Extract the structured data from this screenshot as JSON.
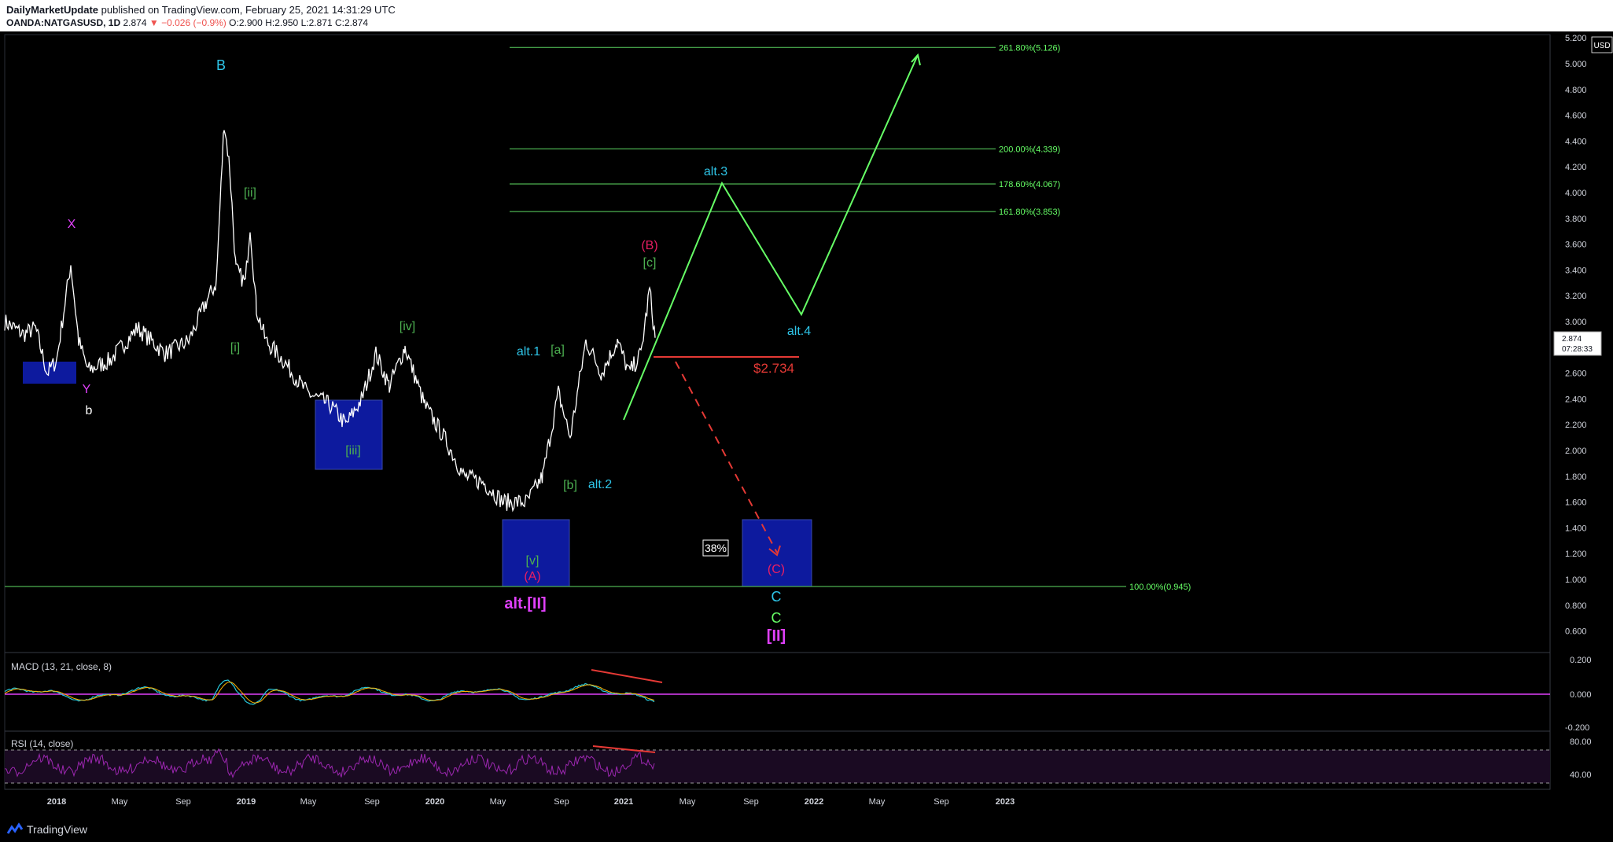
{
  "header": {
    "publisher": "DailyMarketUpdate",
    "published_text": "published on TradingView.com, February 25, 2021 14:31:29 UTC",
    "symbol": "OANDA:NATGASUSD, 1D",
    "last": "2.874",
    "change": "−0.026 (−0.9%)",
    "ohlc_o": "O:2.900",
    "ohlc_h": "H:2.950",
    "ohlc_l": "L:2.871",
    "ohlc_c": "C:2.874"
  },
  "colors": {
    "background": "#000000",
    "price_line": "#ffffff",
    "fib_line": "#4caf50",
    "path_green": "#66ff66",
    "stop_red": "#e53935",
    "zone_blue": "#0d1a9e",
    "cyan": "#2ec5e8",
    "magenta": "#e040fb",
    "macd_fast": "#26c6da",
    "macd_slow": "#ffb300",
    "rsi": "#9c27b0"
  },
  "price_axis": {
    "currency": "USD",
    "ticks": [
      "5.200",
      "5.000",
      "4.800",
      "4.600",
      "4.400",
      "4.200",
      "4.000",
      "3.800",
      "3.600",
      "3.400",
      "3.200",
      "3.000",
      "2.600",
      "2.400",
      "2.200",
      "2.000",
      "1.800",
      "1.600",
      "1.400",
      "1.200",
      "1.000",
      "0.800",
      "0.600"
    ],
    "last_price": "2.874",
    "countdown": "07:28:33"
  },
  "fib_levels": [
    {
      "label": "261.80%(5.126)",
      "value": 5.126
    },
    {
      "label": "200.00%(4.339)",
      "value": 4.339
    },
    {
      "label": "178.60%(4.067)",
      "value": 4.067
    },
    {
      "label": "161.80%(3.853)",
      "value": 3.853
    },
    {
      "label": "100.00%(0.945)",
      "value": 0.945
    }
  ],
  "stop_level": {
    "label": "$2.734",
    "value": 2.734
  },
  "percent_box": "38%",
  "wave_labels": {
    "B": "B",
    "X": "X",
    "Y": "Y",
    "b": "b",
    "ii": "[ii]",
    "i": "[i]",
    "iii": "[iii]",
    "iv": "[iv]",
    "v": "[v]",
    "A": "(A)",
    "alt_II": "alt.[II]",
    "alt1": "alt.1",
    "a": "[a]",
    "b2": "[b]",
    "alt2": "alt.2",
    "Bp": "(B)",
    "c": "[c]",
    "alt3": "alt.3",
    "alt4": "alt.4",
    "C": "(C)",
    "C_cyan": "C",
    "C_green": "C",
    "II": "[II]"
  },
  "time_axis": [
    "2018",
    "May",
    "Sep",
    "2019",
    "May",
    "Sep",
    "2020",
    "May",
    "Sep",
    "2021",
    "May",
    "Sep",
    "2022",
    "May",
    "Sep",
    "2023"
  ],
  "macd": {
    "title": "MACD (13, 21, close, 8)",
    "ticks": [
      "0.200",
      "0.000",
      "-0.200"
    ]
  },
  "rsi": {
    "title": "RSI (14, close)",
    "ticks": [
      "80.00",
      "40.00"
    ]
  },
  "footer": {
    "brand": "TradingView"
  }
}
